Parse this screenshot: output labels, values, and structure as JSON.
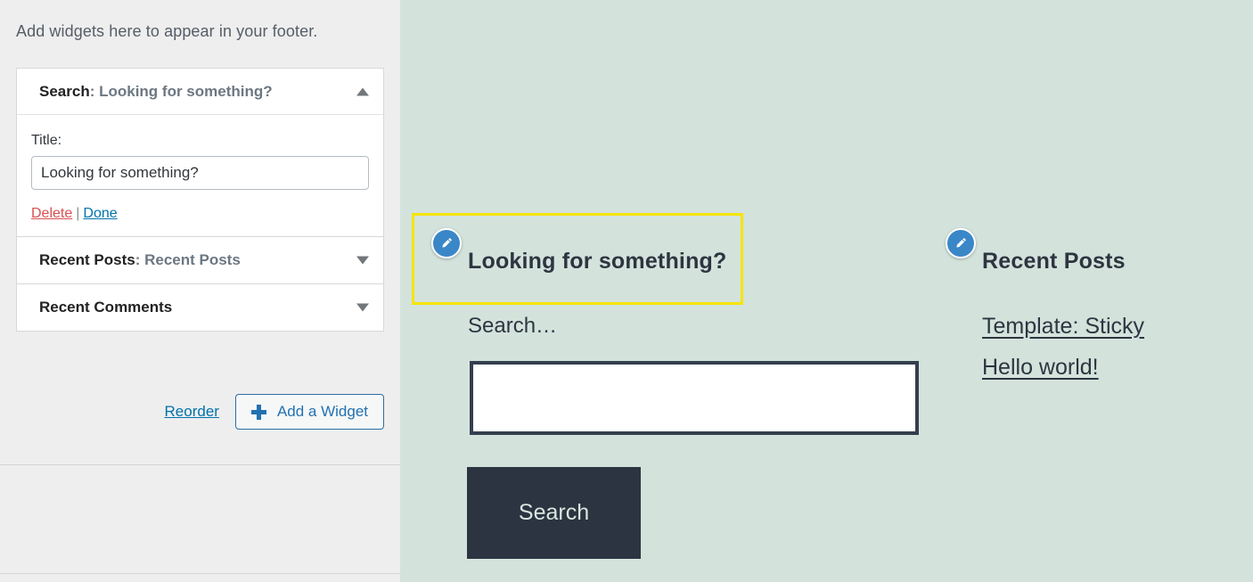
{
  "sidebar": {
    "intro_text": "Add widgets here to appear in your footer.",
    "widgets": [
      {
        "type_label": "Search",
        "title_suffix": ": Looking for something?",
        "state": "expanded",
        "arrow_icon": "caret-up-icon",
        "field_label": "Title:",
        "field_value": "Looking for something?",
        "delete_label": "Delete",
        "separator": "|",
        "done_label": "Done"
      },
      {
        "type_label": "Recent Posts",
        "title_suffix": ": Recent Posts",
        "state": "collapsed",
        "arrow_icon": "caret-down-icon"
      },
      {
        "type_label": "Recent Comments",
        "title_suffix": "",
        "state": "collapsed",
        "arrow_icon": "caret-down-icon"
      }
    ],
    "reorder_label": "Reorder",
    "add_widget_label": "Add a Widget",
    "add_widget_icon": "plus-icon"
  },
  "preview": {
    "background_color": "#d3e3dc",
    "highlight_color": "#f5e400",
    "edit_pin_color": "#3a87c8",
    "edit_pin_icon": "pencil-icon",
    "search_widget": {
      "title": "Looking for something?",
      "label": "Search…",
      "input_value": "",
      "button_label": "Search",
      "button_color": "#2b3440",
      "highlighted": true
    },
    "recent_posts_widget": {
      "title": "Recent Posts",
      "posts": [
        "Template: Sticky",
        "Hello world!"
      ]
    }
  }
}
